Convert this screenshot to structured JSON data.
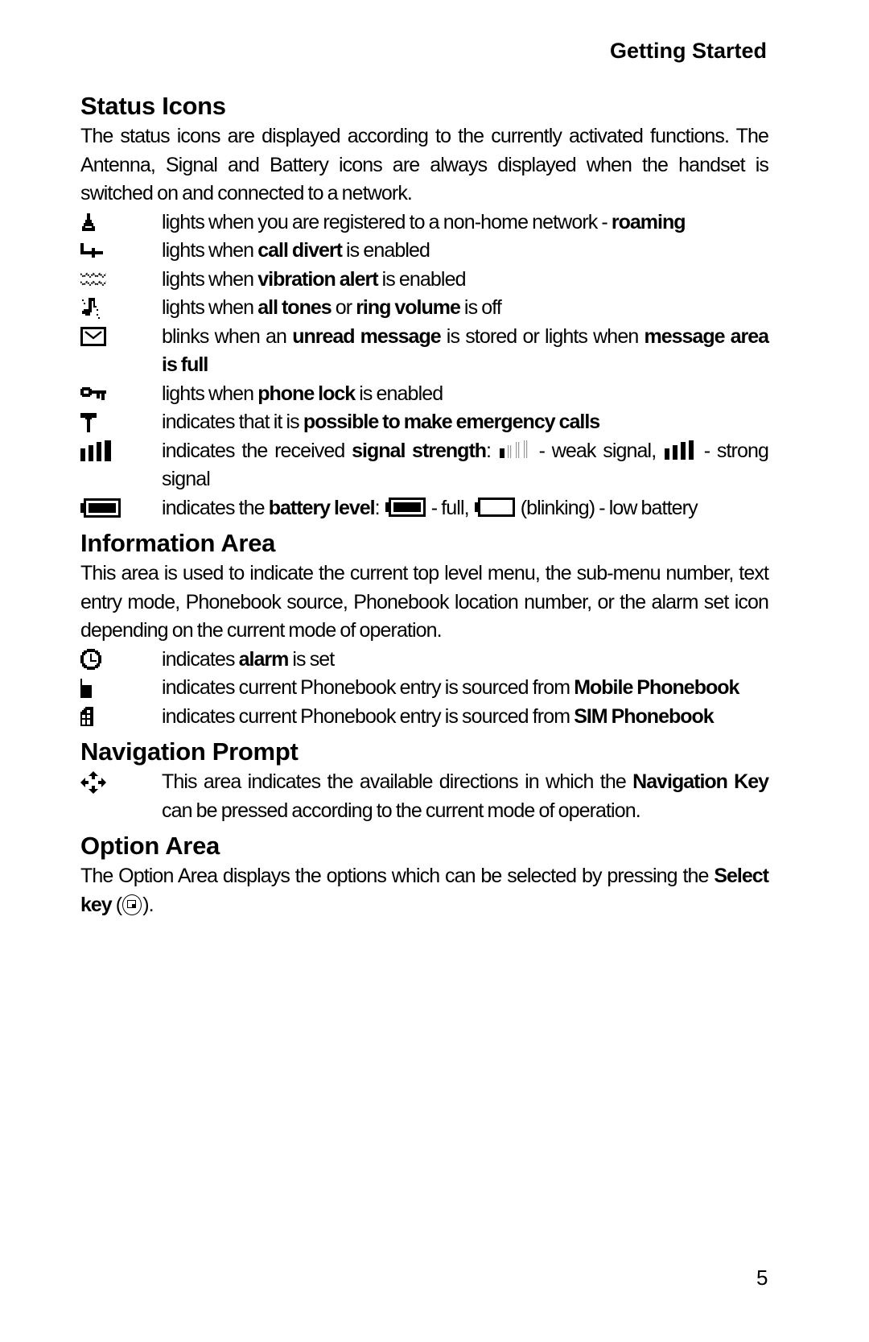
{
  "header": {
    "running_title": "Getting Started",
    "page_number": "5"
  },
  "sections": {
    "status_icons": {
      "title": "Status Icons",
      "intro": "The status icons are displayed according to the currently activated functions. The Antenna, Signal and Battery icons are always displayed when the handset is switched on and connected to a network.",
      "items": [
        {
          "icon": "roaming-icon",
          "parts": [
            "lights when you are registered to a non-home network - ",
            "roaming"
          ]
        },
        {
          "icon": "call-divert-icon",
          "parts": [
            "lights when ",
            "call divert",
            " is enabled"
          ]
        },
        {
          "icon": "vibration-icon",
          "parts": [
            "lights when ",
            "vibration alert",
            " is enabled"
          ]
        },
        {
          "icon": "silent-icon",
          "parts": [
            "lights when ",
            "all tones",
            " or ",
            "ring volume",
            " is off"
          ]
        },
        {
          "icon": "message-icon",
          "parts": [
            "blinks when an ",
            "unread message",
            " is stored or lights when ",
            "message area is full"
          ]
        },
        {
          "icon": "phone-lock-icon",
          "parts": [
            "lights when ",
            "phone lock",
            " is enabled"
          ]
        },
        {
          "icon": "antenna-icon",
          "parts": [
            "indicates that it is ",
            "possible to make emergency calls"
          ]
        },
        {
          "icon": "signal-strength-icon",
          "parts": [
            "indicates the received ",
            "signal strength",
            ": ",
            " - weak signal, ",
            " - strong signal"
          ]
        },
        {
          "icon": "battery-icon",
          "parts": [
            "indicates the ",
            "battery level",
            ": ",
            " - full, ",
            " (blinking) - low battery"
          ]
        }
      ]
    },
    "information_area": {
      "title": "Information Area",
      "intro": "This area is used to indicate the current top level menu, the sub-menu number, text entry mode, Phonebook source, Phonebook location number, or the alarm set icon depending on the current mode of operation.",
      "items": [
        {
          "icon": "alarm-icon",
          "parts": [
            "indicates ",
            "alarm",
            " is set"
          ]
        },
        {
          "icon": "mobile-phonebook-icon",
          "parts": [
            "indicates current Phonebook entry is sourced from ",
            "Mobile Phonebook"
          ]
        },
        {
          "icon": "sim-phonebook-icon",
          "parts": [
            "indicates current Phonebook entry is sourced from ",
            "SIM Phonebook"
          ]
        }
      ]
    },
    "navigation_prompt": {
      "title": "Navigation Prompt",
      "items": [
        {
          "icon": "navigation-arrows-icon",
          "parts": [
            "This area indicates the available directions in which the ",
            "Navigation Key",
            " can be pressed according to the current mode of operation."
          ]
        }
      ]
    },
    "option_area": {
      "title": "Option Area",
      "parts": [
        "The Option Area displays the options which can be selected by pressing the ",
        "Select key",
        " (",
        ")."
      ]
    }
  }
}
